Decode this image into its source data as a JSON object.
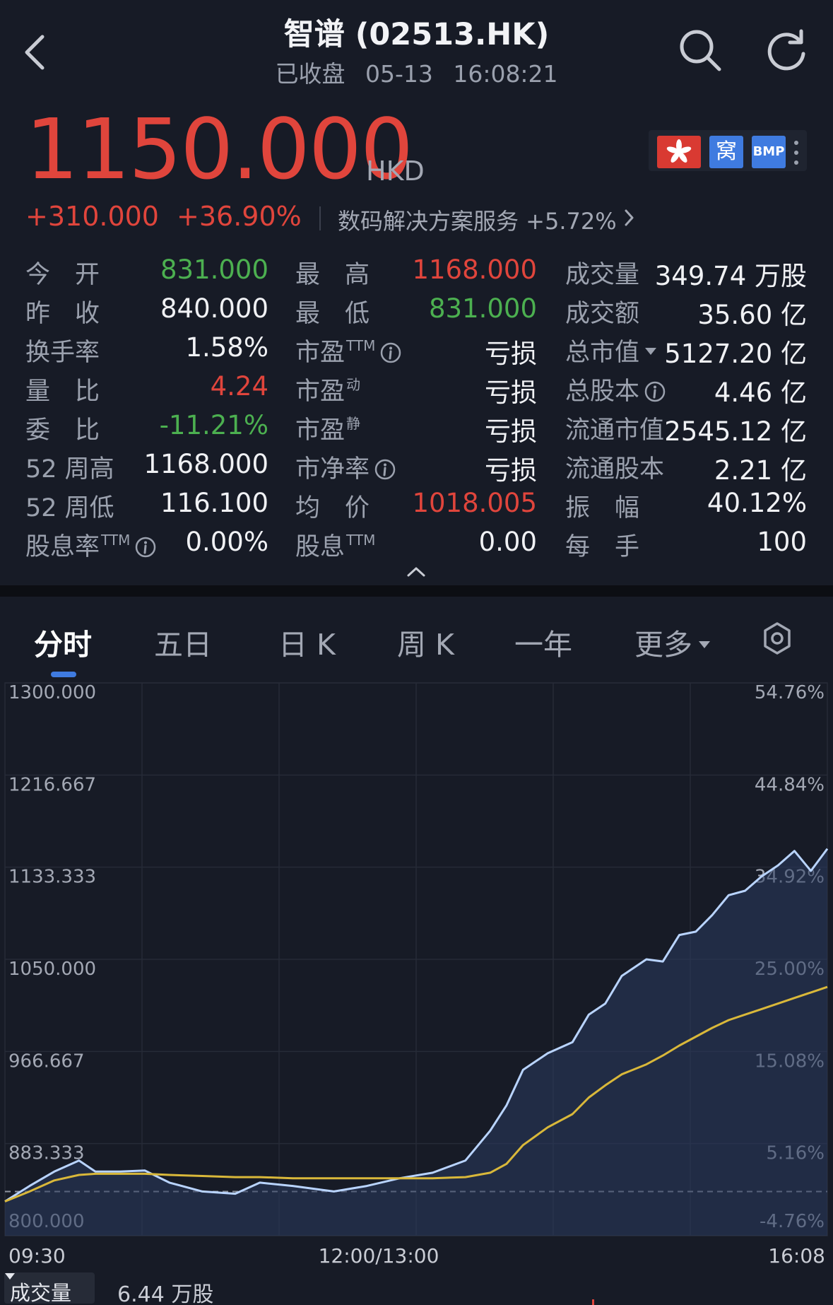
{
  "header": {
    "title": "智谱 (02513.HK)",
    "status": "已收盘",
    "timestamp": "05-13 16:08:21"
  },
  "quote": {
    "price": "1150.000",
    "currency": "HKD",
    "change": "+310.000",
    "change_pct": "+36.90%",
    "sector": "数码解决方案服务 +5.72%",
    "badges": {
      "wo": "窝",
      "bmp": "BMP"
    }
  },
  "stats": {
    "open_label": "今　开",
    "open": "831.000",
    "high_label": "最　高",
    "high": "1168.000",
    "volume_label": "成交量",
    "volume": "349.74 万股",
    "prev_close_label": "昨　收",
    "prev_close": "840.000",
    "low_label": "最　低",
    "low": "831.000",
    "turnover_label": "成交额",
    "turnover": "35.60 亿",
    "turnover_rate_label": "换手率",
    "turnover_rate": "1.58%",
    "pe_ttm_label": "市盈",
    "pe_ttm_sup": "TTM",
    "pe_ttm": "亏损",
    "market_cap_label": "总市值",
    "market_cap": "5127.20 亿",
    "volume_ratio_label": "量　比",
    "volume_ratio": "4.24",
    "pe_dyn_label": "市盈",
    "pe_dyn_sup": "动",
    "pe_dyn": "亏损",
    "total_shares_label": "总股本",
    "total_shares": "4.46 亿",
    "bid_ratio_label": "委　比",
    "bid_ratio": "-11.21%",
    "pe_static_label": "市盈",
    "pe_static_sup": "静",
    "pe_static": "亏损",
    "float_cap_label": "流通市值",
    "float_cap": "2545.12 亿",
    "high52_label": "52 周高",
    "high52": "1168.000",
    "pb_label": "市净率",
    "pb": "亏损",
    "float_shares_label": "流通股本",
    "float_shares": "2.21 亿",
    "low52_label": "52 周低",
    "low52": "116.100",
    "avg_label": "均　价",
    "avg": "1018.005",
    "amplitude_label": "振　幅",
    "amplitude": "40.12%",
    "div_yield_label": "股息率",
    "div_yield_sup": "TTM",
    "div_yield": "0.00%",
    "dividend_label": "股息",
    "dividend_sup": "TTM",
    "dividend": "0.00",
    "lot_label": "每　手",
    "lot": "100"
  },
  "tabs": [
    "分时",
    "五日",
    "日 K",
    "周 K",
    "一年",
    "更多"
  ],
  "volume_bar": {
    "label": "成交量",
    "value": "6.44 万股"
  },
  "colors": {
    "up": "#e0453c",
    "down": "#4cb050",
    "price_line": "#b9d4ff",
    "avg_line": "#d9b83a",
    "accent": "#3f7be0"
  },
  "chart_data": {
    "type": "line",
    "prev_close": 840,
    "ylim": [
      800,
      1300
    ],
    "yticks": [
      1300,
      1216.667,
      1133.333,
      1050,
      966.667,
      883.333,
      800
    ],
    "ytick_labels": [
      "1300.000",
      "1216.667",
      "1133.333",
      "1050.000",
      "966.667",
      "883.333",
      "800.000"
    ],
    "pct_ticks": [
      "54.76%",
      "44.84%",
      "34.92%",
      "25.00%",
      "15.08%",
      "5.16%",
      "-4.76%"
    ],
    "x_labels": [
      "09:30",
      "12:00/13:00",
      "16:08"
    ],
    "x": [
      0,
      0.03,
      0.06,
      0.09,
      0.11,
      0.14,
      0.17,
      0.2,
      0.24,
      0.28,
      0.31,
      0.35,
      0.4,
      0.44,
      0.48,
      0.52,
      0.56,
      0.59,
      0.61,
      0.63,
      0.66,
      0.69,
      0.71,
      0.73,
      0.75,
      0.78,
      0.8,
      0.82,
      0.84,
      0.86,
      0.88,
      0.9,
      0.92,
      0.94,
      0.96,
      0.98,
      1.0
    ],
    "series": [
      {
        "values": [
          831,
          845,
          858,
          868,
          858,
          858,
          859,
          848,
          840,
          838,
          848,
          845,
          840,
          845,
          852,
          857,
          868,
          895,
          918,
          950,
          965,
          975,
          1000,
          1010,
          1035,
          1050,
          1048,
          1072,
          1075,
          1090,
          1108,
          1112,
          1125,
          1135,
          1148,
          1130,
          1150
        ]
      },
      {
        "values": [
          831,
          840,
          850,
          855,
          856,
          856,
          856,
          855,
          854,
          853,
          853,
          852,
          852,
          852,
          852,
          852,
          853,
          857,
          865,
          882,
          898,
          910,
          925,
          936,
          946,
          955,
          963,
          972,
          980,
          988,
          995,
          1000,
          1005,
          1010,
          1015,
          1020,
          1025
        ]
      }
    ]
  }
}
